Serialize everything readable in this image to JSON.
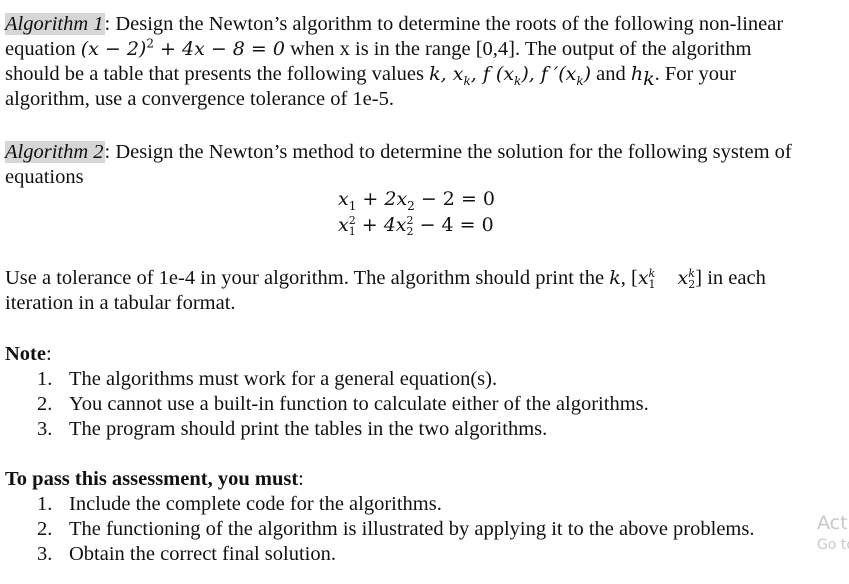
{
  "algorithm1": {
    "label": "Algorithm 1",
    "line1_rest": ": Design the Newton’s algorithm to determine the roots of the following non-linear",
    "line2_pre": "equation ",
    "equation": {
      "part1": "(x − 2)",
      "exp": "2",
      "part2": " + 4x − 8 = 0"
    },
    "line2_post": "  when x is in the range [0,4]. The output of the algorithm",
    "line3_pre": "should be a table that presents the following values ",
    "values": {
      "k": "k, ",
      "xk_base": "x",
      "xk_sub": "k",
      "sep": ",  ",
      "f_open": "f (x",
      "f_sub": "k",
      "f_close": "),",
      "fp_open": " f ′(x",
      "fp_sub": "k",
      "fp_close": ")"
    },
    "and": " and ",
    "hk_base": "h",
    "hk_sub": "k",
    "line3_post": ". For your",
    "line4": "algorithm, use a convergence tolerance of 1e-5."
  },
  "algorithm2": {
    "label": "Algorithm 2",
    "line1_rest": ": Design the Newton’s method to determine the solution for the following system of",
    "line2": "equations",
    "eq1": {
      "a": "x",
      "a_sub": "1",
      "b": " + 2x",
      "b_sub": "2",
      "c": " − 2 = 0"
    },
    "eq2": {
      "a": "x",
      "a_sup": "2",
      "a_sub": "1",
      "b": " + 4x",
      "b_sup": "2",
      "b_sub": "2",
      "c": " − 4 = 0"
    },
    "tol_pre": "Use a tolerance of 1e-4 in your algorithm. The algorithm should print the ",
    "tol_k": "k",
    "tol_bracket_open": ", [",
    "x1": "x",
    "x1_sup": "k",
    "x1_sub": "1",
    "x2": "x",
    "x2_sup": "k",
    "x2_sub": "2",
    "tol_bracket_close": "]",
    "tol_post": " in each",
    "tol_line2": "iteration in a tabular format."
  },
  "note": {
    "heading": "Note",
    "colon": ":",
    "items": [
      {
        "num": "1.",
        "text": "The algorithms must work for a general equation(s)."
      },
      {
        "num": "2.",
        "text": "You cannot use a built-in function to calculate either of the algorithms."
      },
      {
        "num": "3.",
        "text": "The program should print the tables in the two algorithms."
      }
    ]
  },
  "requirements": {
    "heading": "To pass this assessment, you must",
    "colon": ":",
    "items": [
      {
        "num": "1.",
        "text": "Include the complete code for the algorithms."
      },
      {
        "num": "2.",
        "text": "The functioning of the algorithm is illustrated by applying it to the above problems."
      },
      {
        "num": "3.",
        "text": "Obtain the correct final solution."
      }
    ]
  },
  "watermark": {
    "line1": "Acti",
    "line2": "Go to"
  }
}
